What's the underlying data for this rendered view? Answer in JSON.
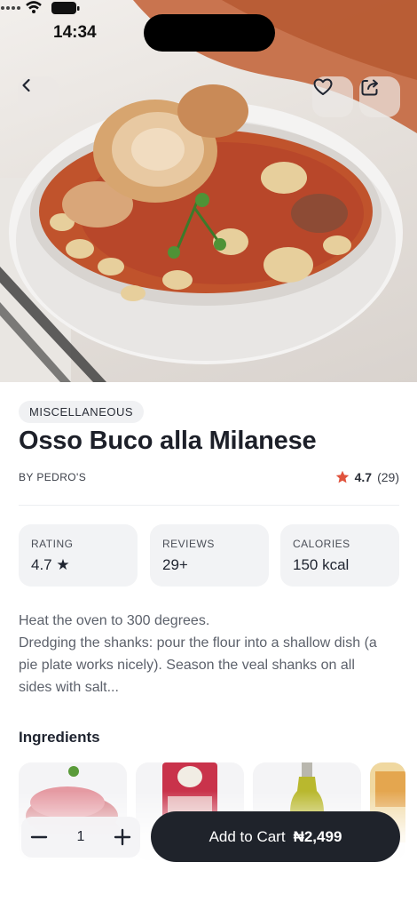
{
  "status_bar": {
    "time": "14:34"
  },
  "product": {
    "category": "MISCELLANEOUS",
    "title": "Osso Buco alla Milanese",
    "vendor": "BY PEDRO'S",
    "rating": "4.7",
    "rating_count": "(29)"
  },
  "stats": [
    {
      "label": "RATING",
      "value": "4.7 ★"
    },
    {
      "label": "REVIEWS",
      "value": "29+"
    },
    {
      "label": "CALORIES",
      "value": "150 kcal"
    }
  ],
  "description": "Heat the oven to 300 degrees.\nDredging the shanks: pour the flour into a shallow dish (a pie plate works nicely). Season the veal shanks on all sides with salt...",
  "ingredients": {
    "title": "Ingredients",
    "items": [
      {
        "icon": "veal-meat-icon"
      },
      {
        "icon": "flour-bag-icon"
      },
      {
        "icon": "olive-oil-bottle-icon"
      },
      {
        "icon": "anchovy-jar-icon"
      }
    ]
  },
  "cart": {
    "quantity": "1",
    "button_label": "Add to Cart",
    "price": "₦2,499"
  },
  "colors": {
    "accent_star": "#e0533d",
    "cart_button": "#1f232b"
  }
}
